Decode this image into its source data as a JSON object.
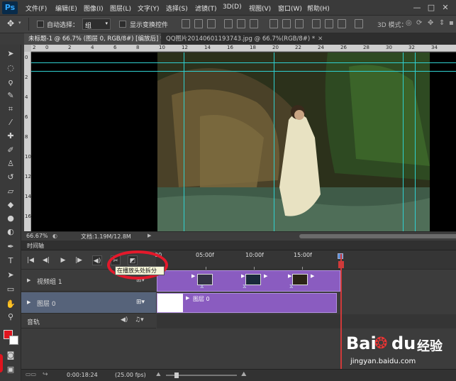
{
  "app": {
    "logo": "Ps"
  },
  "menu": [
    "文件(F)",
    "编辑(E)",
    "图像(I)",
    "图层(L)",
    "文字(Y)",
    "选择(S)",
    "滤镜(T)",
    "3D(D)",
    "视图(V)",
    "窗口(W)",
    "帮助(H)"
  ],
  "window_controls": [
    "—",
    "□",
    "✕"
  ],
  "options": {
    "auto_select_label": "自动选择：",
    "auto_select_value": "组",
    "transform_label": "显示变换控件",
    "mode_3d": "3D 模式："
  },
  "tabs": [
    {
      "label": "未标题-1 @ 66.7% (图层 0, RGB/8#) [编放后] *",
      "close": "✕"
    },
    {
      "label": "QQ图片20140601193743.jpg @ 66.7%(RGB/8#) *",
      "close": "✕"
    }
  ],
  "ruler_top": [
    "2",
    "0",
    "2",
    "4",
    "6",
    "8",
    "10",
    "12",
    "14",
    "16",
    "18",
    "20",
    "22",
    "24",
    "26",
    "28",
    "30",
    "32",
    "34"
  ],
  "ruler_left": [
    "0",
    "2",
    "4",
    "6",
    "8",
    "10",
    "12",
    "14",
    "16"
  ],
  "status": {
    "zoom": "66.67%",
    "doc": "文档:1.19M/12.8M"
  },
  "timeline": {
    "title": "时间轴",
    "marks": [
      "00",
      "05:00f",
      "10:00f",
      "15:00f"
    ],
    "tooltip": "在播放头处拆分",
    "rows": [
      {
        "label": "视频组 1"
      },
      {
        "label": "图层 0"
      },
      {
        "label": "音轨"
      }
    ],
    "clip_label": "图层 0",
    "timecode": "0:00:18:24",
    "fps": "(25.00 fps)"
  },
  "watermark": {
    "brand": "Bai",
    "brand2": "du",
    "brand_cn": "经验",
    "url": "jingyan.baidu.com"
  }
}
